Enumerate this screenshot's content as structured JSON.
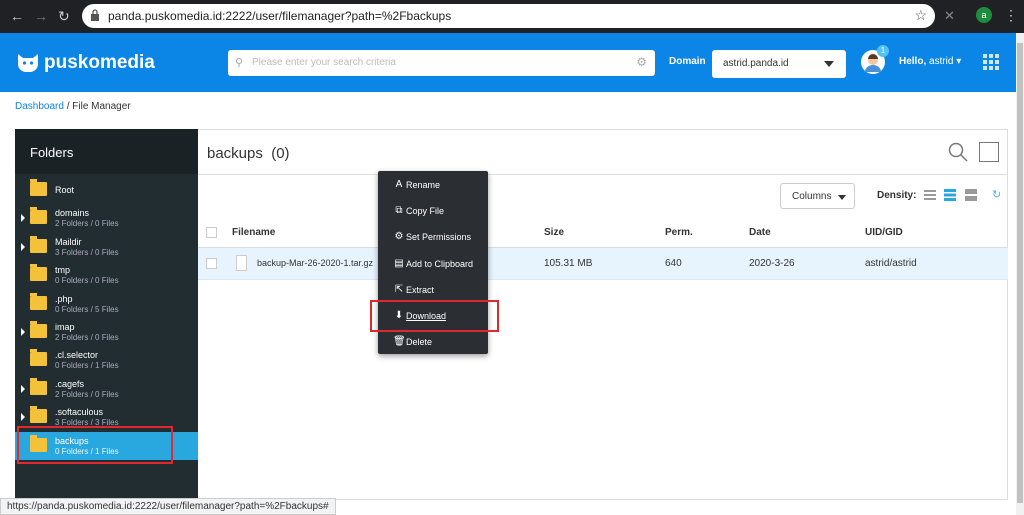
{
  "browser": {
    "url": "panda.puskomedia.id:2222/user/filemanager?path=%2Fbackups",
    "profile_initial": "a"
  },
  "header": {
    "logo_text": "puskomedia",
    "search_placeholder": "Please enter your search criteria",
    "domain_label": "Domain",
    "domain_value": "astrid.panda.id",
    "notification_count": "1",
    "greeting": "Hello,",
    "username": "astrid",
    "brand_color": "#0b86e6"
  },
  "breadcrumb": {
    "home": "Dashboard",
    "separator": " / ",
    "current": "File Manager"
  },
  "sidebar": {
    "title": "Folders",
    "items": [
      {
        "name": "Root",
        "info": "",
        "expandable": false
      },
      {
        "name": "domains",
        "info": "2 Folders / 0 Files",
        "expandable": true
      },
      {
        "name": "Maildir",
        "info": "3 Folders / 0 Files",
        "expandable": true
      },
      {
        "name": "tmp",
        "info": "0 Folders / 0 Files",
        "expandable": false
      },
      {
        "name": ".php",
        "info": "0 Folders / 5 Files",
        "expandable": false
      },
      {
        "name": "imap",
        "info": "2 Folders / 0 Files",
        "expandable": true
      },
      {
        "name": ".cl.selector",
        "info": "0 Folders / 1 Files",
        "expandable": false
      },
      {
        "name": ".cagefs",
        "info": "2 Folders / 0 Files",
        "expandable": true
      },
      {
        "name": ".softaculous",
        "info": "3 Folders / 3 Files",
        "expandable": true
      },
      {
        "name": "backups",
        "info": "0 Folders / 1 Files",
        "expandable": false,
        "active": true
      }
    ]
  },
  "main": {
    "folder_title": "backups",
    "folder_count": "(0)",
    "columns_button": "Columns",
    "density_label": "Density:",
    "table_headers": [
      "Filename",
      "Size",
      "Perm.",
      "Date",
      "UID/GID"
    ],
    "rows": [
      {
        "filename": "backup-Mar-26-2020-1.tar.gz",
        "size": "105.31 MB",
        "perm": "640",
        "date": "2020-3-26",
        "uid": "astrid/astrid"
      }
    ]
  },
  "context_menu": {
    "items": [
      {
        "label": "Rename",
        "icon": "rename-icon",
        "glyph": "A"
      },
      {
        "label": "Copy File",
        "icon": "copy-icon",
        "glyph": "⧉"
      },
      {
        "label": "Set Permissions",
        "icon": "permissions-icon",
        "glyph": "⚙"
      },
      {
        "label": "Add to Clipboard",
        "icon": "clipboard-icon",
        "glyph": "▤"
      },
      {
        "label": "Extract",
        "icon": "extract-icon",
        "glyph": "⇱"
      },
      {
        "label": "Download",
        "icon": "download-icon",
        "glyph": "⬇"
      },
      {
        "label": "Delete",
        "icon": "trash-icon",
        "glyph": "🗑"
      }
    ]
  },
  "status_bar": {
    "link": "https://panda.puskomedia.id:2222/user/filemanager?path=%2Fbackups#"
  }
}
